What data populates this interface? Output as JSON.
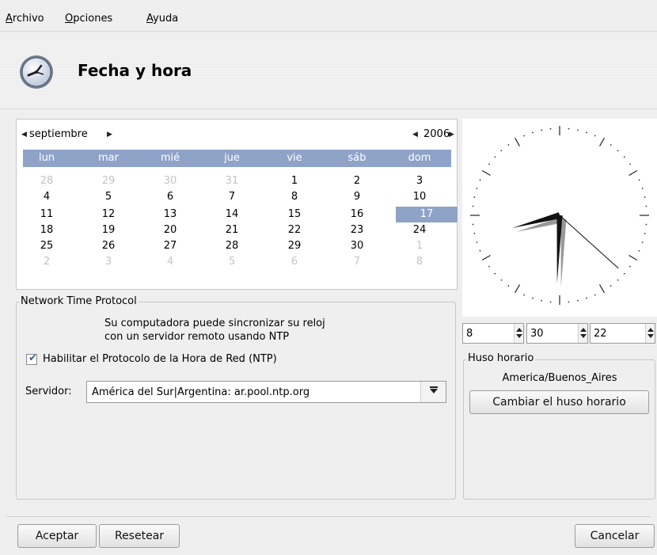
{
  "menubar": {
    "items": [
      {
        "first": "A",
        "rest": "rchivo"
      },
      {
        "first": "O",
        "rest": "pciones"
      },
      {
        "first": "A",
        "rest": "yuda"
      }
    ]
  },
  "header": {
    "title": "Fecha y hora",
    "icon": "clock-icon"
  },
  "calendar": {
    "month": "septiembre",
    "year": "2006",
    "weekdays": [
      "lun",
      "mar",
      "mié",
      "jue",
      "vie",
      "sáb",
      "dom"
    ],
    "weeks": [
      [
        "28",
        "29",
        "30",
        "31",
        "1",
        "2",
        "3"
      ],
      [
        "4",
        "5",
        "6",
        "7",
        "8",
        "9",
        "10"
      ],
      [
        "11",
        "12",
        "13",
        "14",
        "15",
        "16",
        "17"
      ],
      [
        "18",
        "19",
        "20",
        "21",
        "22",
        "23",
        "24"
      ],
      [
        "25",
        "26",
        "27",
        "28",
        "29",
        "30",
        "1"
      ],
      [
        "2",
        "3",
        "4",
        "5",
        "6",
        "7",
        "8"
      ]
    ],
    "selected_day": "17"
  },
  "time": {
    "hour": "8",
    "minute": "30",
    "second": "22"
  },
  "ntp": {
    "group_title": "Network Time Protocol",
    "description_line1": "Su computadora puede sincronizar su reloj",
    "description_line2": "con un servidor remoto usando NTP",
    "enable_label": "Habilitar el Protocolo de la Hora de Red (NTP)",
    "enabled": true,
    "server_label": "Servidor:",
    "server_value": "América del Sur|Argentina: ar.pool.ntp.org"
  },
  "timezone": {
    "group_title": "Huso horario",
    "value": "America/Buenos_Aires",
    "change_button": "Cambiar el huso horario"
  },
  "buttons": {
    "ok": "Aceptar",
    "reset": "Resetear",
    "cancel": "Cancelar"
  },
  "colors": {
    "selection": "#8fa3c9",
    "accent": "#3a5fa8"
  }
}
